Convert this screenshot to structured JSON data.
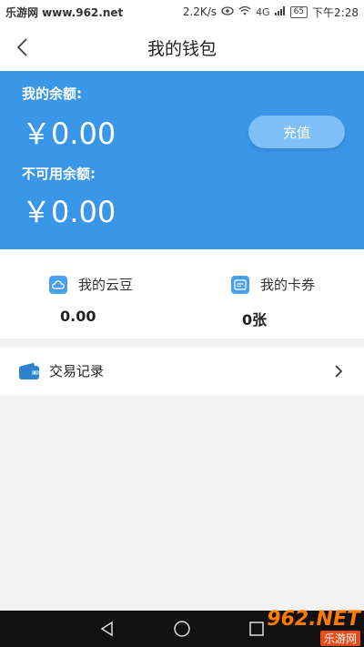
{
  "statusbar": {
    "watermark": "乐游网 www.962.net",
    "network_speed": "2.2K/s",
    "signal_label": "4G",
    "battery": "65",
    "time": "下午2:28"
  },
  "header": {
    "title": "我的钱包"
  },
  "balance": {
    "available_label": "我的余额:",
    "available_amount": "￥0.00",
    "unavailable_label": "不可用余额:",
    "unavailable_amount": "￥0.00",
    "recharge_label": "充值"
  },
  "assets": {
    "cloud_beans_label": "我的云豆",
    "cloud_beans_value": "0.00",
    "coupons_label": "我的卡券",
    "coupons_value": "0张"
  },
  "records": {
    "label": "交易记录"
  },
  "watermark_br": {
    "main": "962.NET",
    "sub": "乐游网"
  },
  "colors": {
    "accent": "#3a97e8",
    "recharge_button": "#7ec0f7",
    "icon_blue": "#4aa0ec"
  }
}
